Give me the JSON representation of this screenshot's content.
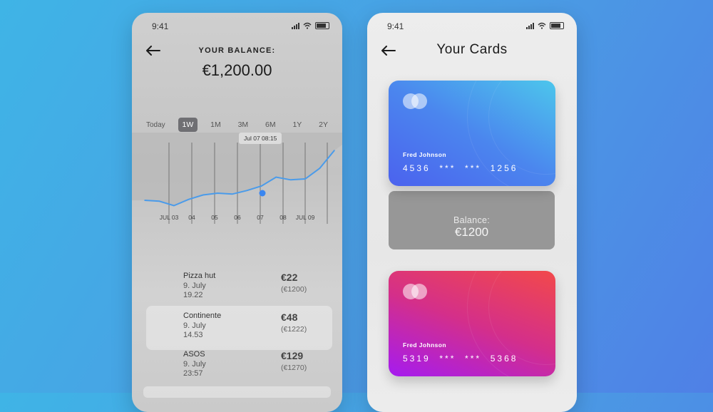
{
  "status_bar": {
    "time": "9:41"
  },
  "balance_screen": {
    "label": "YOUR BALANCE:",
    "amount": "€1,200.00",
    "periods": [
      "Today",
      "1W",
      "1M",
      "3M",
      "6M",
      "1Y",
      "2Y"
    ],
    "active_period": "1W",
    "tooltip": "Jul 07 08:15",
    "x_labels": [
      "JUL 03",
      "04",
      "05",
      "06",
      "07",
      "08",
      "JUL 09"
    ],
    "transactions": [
      {
        "name": "Pizza hut",
        "date": "9. July",
        "time": "19.22",
        "amount": "€22",
        "running": "(€1200)"
      },
      {
        "name": "Continente",
        "date": "9. July",
        "time": "14.53",
        "amount": "€48",
        "running": "(€1222)"
      },
      {
        "name": "ASOS",
        "date": "9. July",
        "time": "23:57",
        "amount": "€129",
        "running": "(€1270)"
      }
    ]
  },
  "cards_screen": {
    "title": "Your Cards",
    "balance_label": "Balance:",
    "balance_value": "€1200",
    "cards": [
      {
        "holder": "Fred Johnson",
        "number": "4536  ***  ***  1256"
      },
      {
        "holder": "Fred Johnson",
        "number": "5319  ***  ***  5368"
      }
    ]
  },
  "colors": {
    "background": "#4a9de4",
    "chart_line": "#4a9bea",
    "active_period_bg": "#6f6f73",
    "card1_gradient": [
      "#4cc6ec",
      "#4b62ee"
    ],
    "card2_gradient": [
      "#f2494a",
      "#a51bf0"
    ]
  },
  "chart_data": {
    "type": "line",
    "line_color": "#4a9bea",
    "values": [
      920,
      915,
      890,
      925,
      950,
      960,
      955,
      975,
      1000,
      1050,
      1035,
      1040,
      1100,
      1200
    ],
    "grid": true
  }
}
